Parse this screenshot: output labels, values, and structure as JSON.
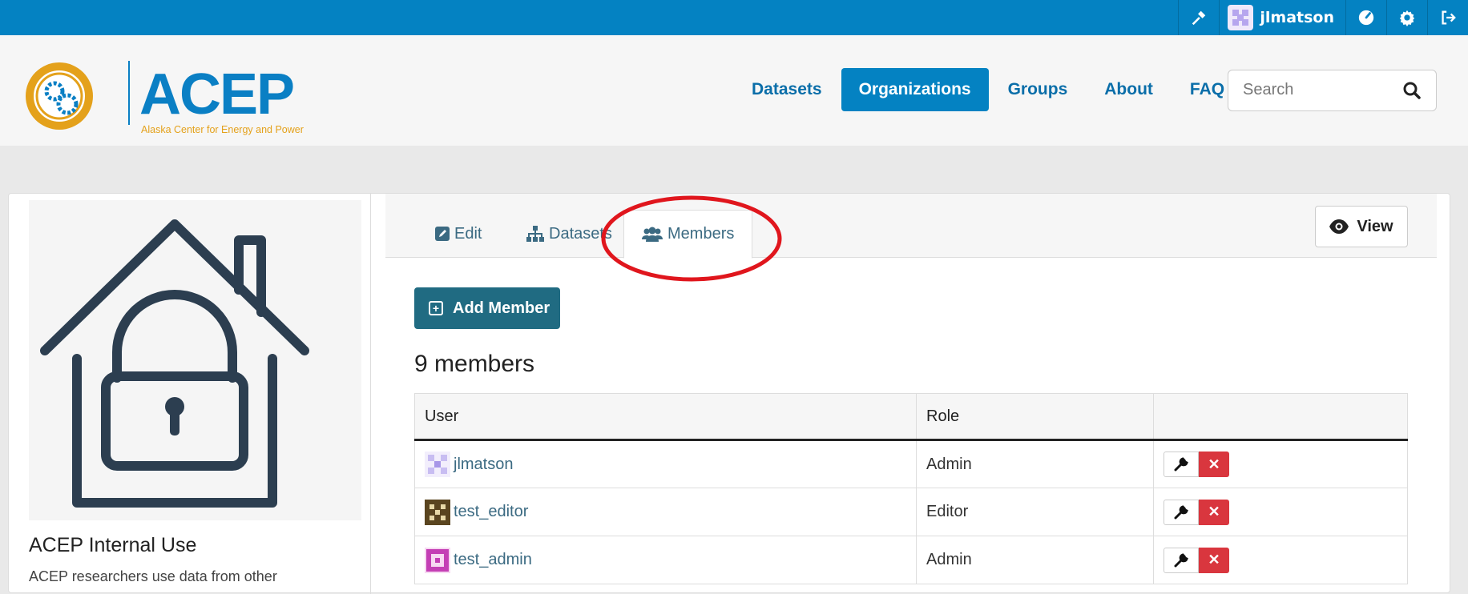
{
  "account": {
    "username": "jlmatson",
    "icons": [
      "sysadmin-hammer-icon",
      "dashboard-icon",
      "settings-gear-icon",
      "logout-icon"
    ]
  },
  "brand": {
    "name": "ACEP",
    "subtitle": "Alaska Center for Energy and Power",
    "colors": {
      "primary": "#0482c2",
      "gold": "#e4a11b",
      "teal": "#206b82",
      "danger": "#d9363e"
    }
  },
  "nav": {
    "items": [
      {
        "label": "Datasets"
      },
      {
        "label": "Organizations",
        "active": true
      },
      {
        "label": "Groups"
      },
      {
        "label": "About"
      },
      {
        "label": "FAQ"
      }
    ]
  },
  "search": {
    "placeholder": "Search",
    "value": ""
  },
  "organization": {
    "title": "ACEP Internal Use",
    "description": "ACEP researchers use data from other"
  },
  "tabs": [
    {
      "label": "Edit",
      "icon": "edit-icon"
    },
    {
      "label": "Datasets",
      "icon": "sitemap-icon"
    },
    {
      "label": "Members",
      "icon": "users-icon",
      "active": true
    }
  ],
  "actions": {
    "view_label": "View",
    "add_member_label": "Add Member"
  },
  "members": {
    "count_label": "9 members",
    "headers": [
      "User",
      "Role",
      ""
    ],
    "rows": [
      {
        "user": "jlmatson",
        "role": "Admin"
      },
      {
        "user": "test_editor",
        "role": "Editor"
      },
      {
        "user": "test_admin",
        "role": "Admin"
      }
    ]
  }
}
